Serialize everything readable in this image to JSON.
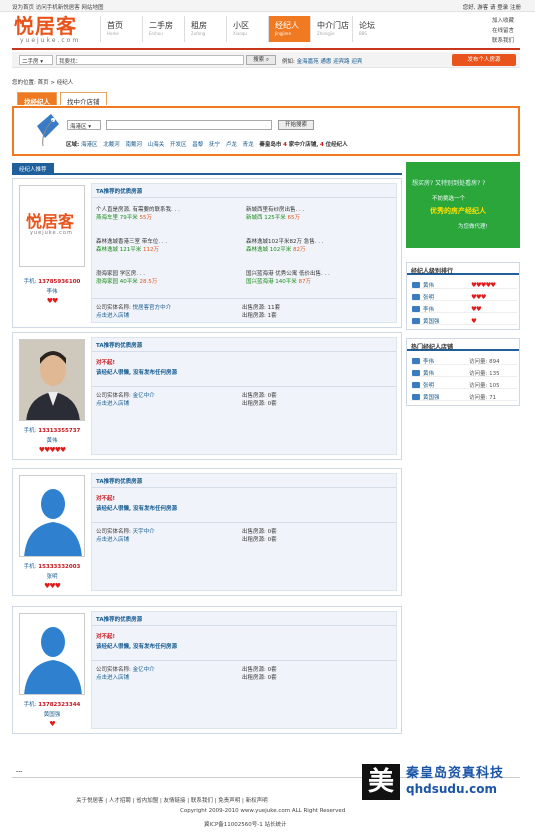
{
  "topbar": {
    "left": "设为首页  访问手机新悦居客  网站地图",
    "right": "您好, 游客 请 登录 注册"
  },
  "logo": {
    "cn": "悦居客",
    "en": "yuejuke.com"
  },
  "nav": [
    {
      "cn": "首页",
      "en": "Home"
    },
    {
      "cn": "二手房",
      "en": "Ershou"
    },
    {
      "cn": "租房",
      "en": "Zufang"
    },
    {
      "cn": "小区",
      "en": "Xiaoqu"
    },
    {
      "cn": "经纪人",
      "en": "Jingjiren"
    },
    {
      "cn": "中介门店",
      "en": "Zhongjie"
    },
    {
      "cn": "论坛",
      "en": "BBS"
    }
  ],
  "quick": [
    "加入收藏",
    "在线留言",
    "联系我们"
  ],
  "search": {
    "select": "二手房",
    "placeholder": "我要找：",
    "button": "搜索",
    "hot_label": "例如:",
    "hot": [
      "金海嘉苑",
      "通惠",
      "迎宾路",
      "迎宾"
    ],
    "publish": "发布个人房源"
  },
  "breadcrumb": "您的位置: 首页 > 经纪人",
  "tabs": [
    "找经纪人",
    "找中介店铺"
  ],
  "filter": {
    "area_select": "海港区",
    "keyword": "",
    "button": "开始搜索",
    "region_label": "区域:",
    "areas": [
      "海港区",
      "北戴河",
      "南戴河",
      "山海关",
      "开发区",
      "昌黎",
      "抚宁",
      "卢龙",
      "青龙"
    ],
    "summary_city": "秦皇岛市",
    "summary_a": "4",
    "summary_a_txt": "家中介店铺,",
    "summary_b": "4",
    "summary_b_txt": "位经纪人"
  },
  "section_title": "经纪人推荐",
  "cards": [
    {
      "head": "TA推荐的优质房源",
      "phone_label": "手机:",
      "phone": "13785936100",
      "name": "李伟",
      "stars": "♥♥",
      "listings": [
        {
          "t": "个人直是房源, 有需要的联系我. . .",
          "p": "燕海车里",
          "a": "79平米",
          "r": "55万"
        },
        {
          "t": "新城西里有纱房出售. . .",
          "p": "新城西",
          "a": "125平米",
          "r": "65万"
        },
        {
          "t": "森林逸城香港三室  带车位. . .",
          "p": "森林逸城",
          "a": "121平米",
          "r": "112万"
        },
        {
          "t": "森林逸城102平米82万  急售. . .",
          "p": "森林逸城",
          "a": "102平米",
          "r": "82万"
        },
        {
          "t": "渤海家园  学区房. . .",
          "p": "渤海家园",
          "a": "40平米",
          "r": "28.5万"
        },
        {
          "t": "国兴蓝海港  优秀公寓  低价出售. . .",
          "p": "国兴蓝海港",
          "a": "140平米",
          "r": "87万"
        }
      ],
      "co_label": "公司实体名称:",
      "company": "悦居客官方中介",
      "enter": "点击进入店铺",
      "sale": "出售房源: 11套",
      "rent": "出租房源: 1套"
    },
    {
      "head": "TA推荐的优质房源",
      "phone_label": "手机:",
      "phone": "13313355737",
      "name": "黄伟",
      "stars": "♥♥♥♥♥",
      "sorry": "对不起!",
      "sorry2": "该经纪人很懒, 没有发布任何房源",
      "co_label": "公司实体名称:",
      "company": "金亿中介",
      "enter": "点击进入店铺",
      "sale": "出售房源: 0套",
      "rent": "出租房源: 0套"
    },
    {
      "head": "TA推荐的优质房源",
      "phone_label": "手机:",
      "phone": "15333332003",
      "name": "张明",
      "stars": "♥♥♥",
      "sorry": "对不起!",
      "sorry2": "该经纪人很懒, 没有发布任何房源",
      "co_label": "公司实体名称:",
      "company": "天宇中介",
      "enter": "点击进入店铺",
      "sale": "出售房源: 0套",
      "rent": "出租房源: 0套"
    },
    {
      "head": "TA推荐的优质房源",
      "phone_label": "手机:",
      "phone": "13782323344",
      "name": "黄国强",
      "stars": "♥",
      "sorry": "对不起!",
      "sorry2": "该经纪人很懒, 没有发布任何房源",
      "co_label": "公司实体名称:",
      "company": "金亿中介",
      "enter": "点击进入店铺",
      "sale": "出售房源: 0套",
      "rent": "出租房源: 0套"
    }
  ],
  "banner": {
    "t1": "想买房? 又特别到处看房? ?",
    "t2": "不妨挑选一个",
    "t3": "优秀的房产经纪人",
    "t4": "为您做代理!"
  },
  "rank": {
    "title": "经纪人级别排行",
    "rows": [
      {
        "n": "黄伟",
        "v": "♥♥♥♥♥"
      },
      {
        "n": "张明",
        "v": "♥♥♥"
      },
      {
        "n": "李伟",
        "v": "♥♥"
      },
      {
        "n": "黄国强",
        "v": "♥"
      }
    ]
  },
  "hot_shops": {
    "title": "热门经纪人店铺",
    "rows": [
      {
        "n": "李伟",
        "v": "访问量: 894"
      },
      {
        "n": "黄伟",
        "v": "访问量: 135"
      },
      {
        "n": "张明",
        "v": "访问量: 105"
      },
      {
        "n": "黄国强",
        "v": "访问量: 71"
      }
    ]
  },
  "footer": {
    "ellipsis": "...",
    "links": "关于悦居客  |  人才招聘  |  省内加盟  |  友情链接  |  联系我们  |  免责声明  |  新权声明",
    "copy": "Copyright 2009-2010 www.yuejuke.com ALL Right Reserved",
    "icp": "冀ICP备11002560号-1    站长统计"
  },
  "watermark": {
    "char": "美",
    "t1": "秦皇岛资真科技",
    "t2": "qhdsudu.com"
  },
  "colors": {
    "accent": "#ef7a22",
    "brand": "#c8361d",
    "link": "#14598f"
  }
}
